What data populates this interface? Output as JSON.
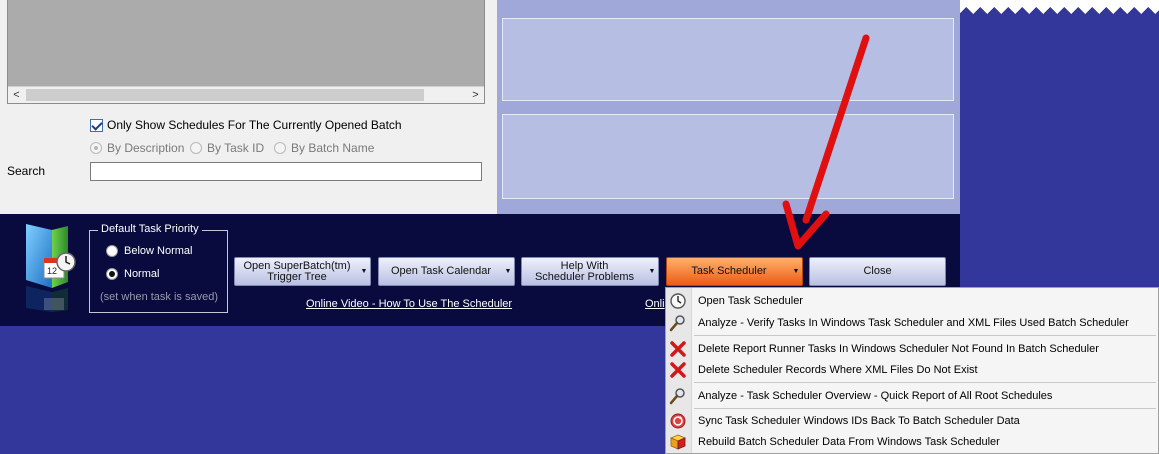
{
  "list": {
    "scroll_left_icon": "chevron-left-icon",
    "scroll_right_icon": "chevron-right-icon"
  },
  "filter": {
    "only_current_batch_label": "Only Show Schedules For The Currently Opened Batch",
    "only_current_batch_checked": true,
    "by_description": "By Description",
    "by_task_id": "By Task ID",
    "by_batch_name": "By Batch Name",
    "selected_mode": "By Description"
  },
  "search": {
    "label": "Search",
    "value": ""
  },
  "priority": {
    "legend": "Default Task Priority",
    "below_normal": "Below Normal",
    "normal": "Normal",
    "selected": "Normal",
    "note": "(set when task is saved)"
  },
  "buttons": {
    "open_tree": "Open SuperBatch(tm)\nTrigger Tree",
    "open_calendar": "Open Task Calendar",
    "help": "Help With\nScheduler Problems",
    "task_scheduler": "Task Scheduler",
    "close": "Close"
  },
  "links": {
    "video": "Online Video - How To Use The Scheduler",
    "second_partial": "Onli"
  },
  "menu": {
    "items": [
      {
        "label": "Open Task Scheduler",
        "icon": "clock-icon"
      },
      {
        "label": "Analyze - Verify Tasks In Windows Task Scheduler and XML Files Used Batch Scheduler",
        "icon": "magnifier-icon"
      },
      {
        "label": "Delete Report Runner Tasks In Windows Scheduler Not Found In Batch Scheduler",
        "icon": "red-x-icon"
      },
      {
        "label": "Delete Scheduler Records Where XML Files Do Not Exist",
        "icon": "red-x-icon"
      },
      {
        "label": "Analyze - Task Scheduler Overview - Quick Report of All Root Schedules",
        "icon": "magnifier-icon"
      },
      {
        "label": "Sync Task Scheduler Windows IDs Back To Batch Scheduler Data",
        "icon": "sync-icon"
      },
      {
        "label": "Rebuild Batch Scheduler Data From Windows Task Scheduler",
        "icon": "cube-icon"
      }
    ]
  },
  "colors": {
    "background": "#33369a",
    "bottom_bar": "#090b3e",
    "active_button": "#ec5c17",
    "annotation_arrow": "#e01010"
  }
}
